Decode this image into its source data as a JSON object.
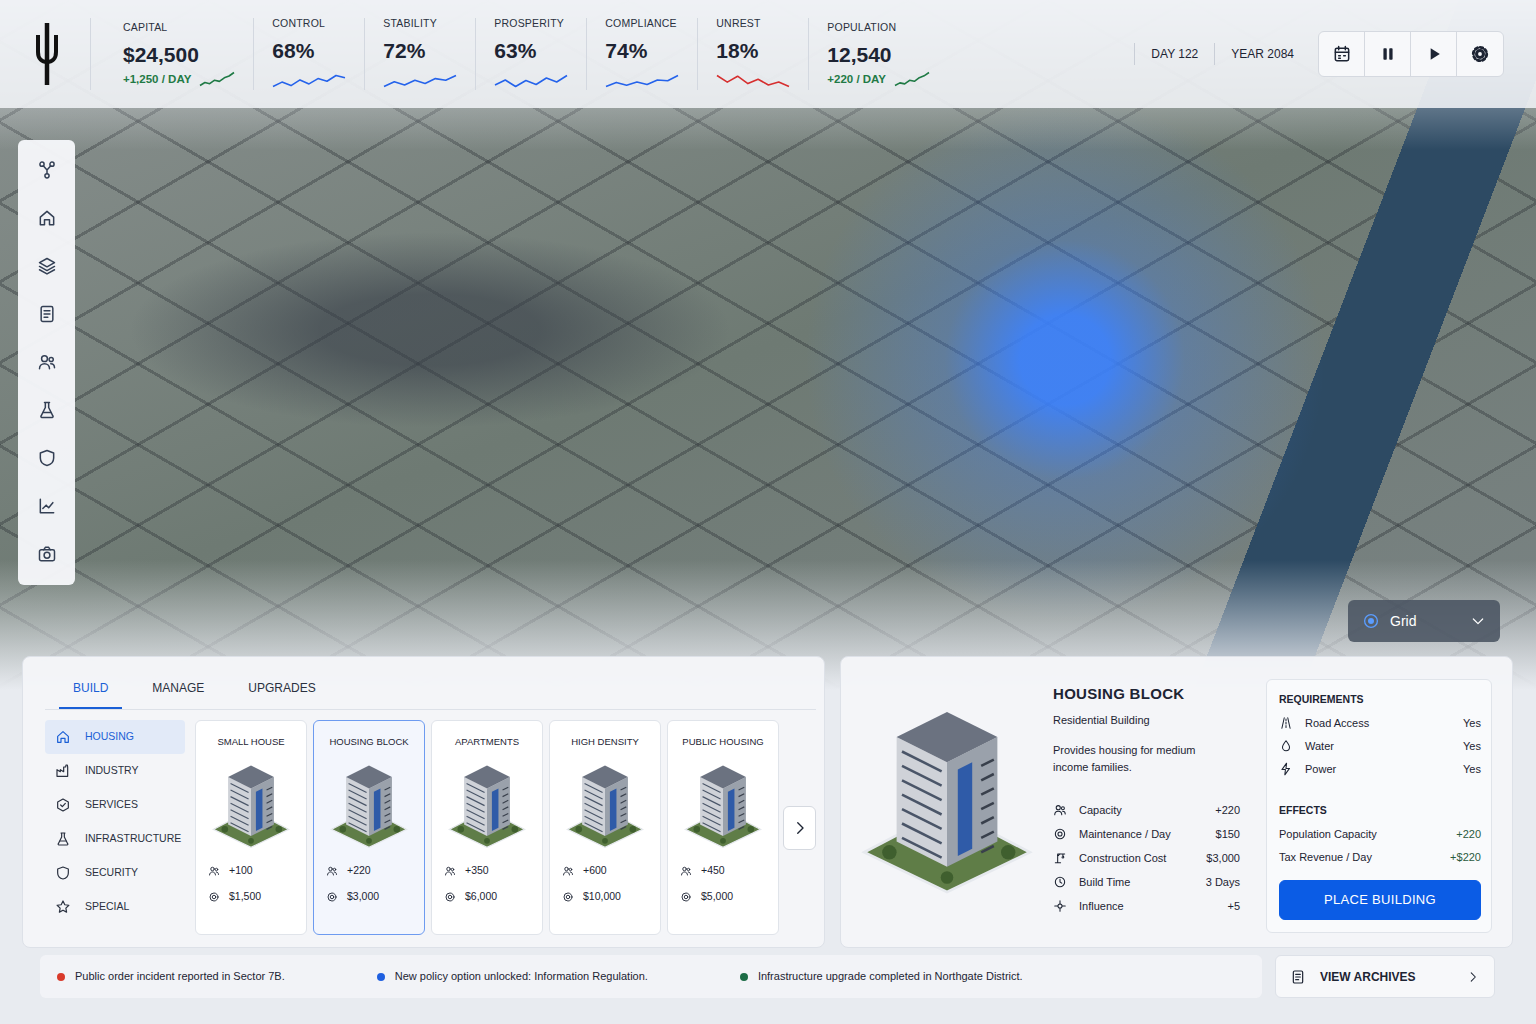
{
  "stats": [
    {
      "label": "CAPITAL",
      "value": "$24,500",
      "delta": "+1,250 / DAY",
      "trend": [
        2,
        3,
        2.6,
        3.8,
        3.4,
        4.6,
        5.2,
        6.4
      ],
      "color": "#1f7a45"
    },
    {
      "label": "CONTROL",
      "value": "68%",
      "trend": [
        3,
        4,
        3.2,
        4.5,
        3.6,
        4.8,
        4.2,
        5.5,
        5
      ],
      "color": "#2563eb"
    },
    {
      "label": "STABILITY",
      "value": "72%",
      "trend": [
        3,
        4.2,
        3.4,
        4.6,
        3.8,
        5,
        4.6,
        5.8
      ],
      "color": "#2563eb"
    },
    {
      "label": "PROSPERITY",
      "value": "63%",
      "trend": [
        3.5,
        4.5,
        3.2,
        4.4,
        3.6,
        4.9,
        4.1,
        5.4
      ],
      "color": "#2563eb"
    },
    {
      "label": "COMPLIANCE",
      "value": "74%",
      "trend": [
        3,
        4,
        3.3,
        4.1,
        3.5,
        4.6,
        4.4,
        5.7
      ],
      "color": "#2563eb"
    },
    {
      "label": "UNREST",
      "value": "18%",
      "trend": [
        4.5,
        3.6,
        4.4,
        3.4,
        4,
        3.2,
        3.6,
        3
      ],
      "color": "#d62f2f"
    },
    {
      "label": "POPULATION",
      "value": "12,540",
      "delta": "+220 / DAY",
      "trend": [
        2,
        2.8,
        2.5,
        3.6,
        3.3,
        4.4,
        5,
        6
      ],
      "color": "#1f7a45"
    }
  ],
  "clock": {
    "day": "DAY 122",
    "year": "YEAR 2084"
  },
  "controls": [
    {
      "kind": "calendar"
    },
    {
      "kind": "pause"
    },
    {
      "kind": "play"
    },
    {
      "kind": "settings"
    }
  ],
  "sidebar": {
    "items": [
      {
        "kind": "network"
      },
      {
        "kind": "home"
      },
      {
        "kind": "layers"
      },
      {
        "kind": "document"
      },
      {
        "kind": "people"
      },
      {
        "kind": "flask"
      },
      {
        "kind": "shield"
      },
      {
        "kind": "chart"
      },
      {
        "kind": "camera"
      }
    ]
  },
  "map_overlay": {
    "label": "Grid",
    "expanded": false
  },
  "build_panel": {
    "tabs": [
      {
        "label": "BUILD",
        "selected": true
      },
      {
        "label": "MANAGE",
        "selected": false
      },
      {
        "label": "UPGRADES",
        "selected": false
      }
    ],
    "categories": [
      {
        "label": "HOUSING",
        "kind": "home",
        "selected": true
      },
      {
        "label": "INDUSTRY",
        "kind": "factory",
        "selected": false
      },
      {
        "label": "SERVICES",
        "kind": "services",
        "selected": false
      },
      {
        "label": "INFRASTRUCTURE",
        "kind": "flask",
        "selected": false
      },
      {
        "label": "SECURITY",
        "kind": "shield",
        "selected": false
      },
      {
        "label": "SPECIAL",
        "kind": "star",
        "selected": false
      }
    ],
    "buildings": [
      {
        "name": "SMALL HOUSE",
        "capacity": "+100",
        "cost": "$1,500",
        "selected": false
      },
      {
        "name": "HOUSING BLOCK",
        "capacity": "+220",
        "cost": "$3,000",
        "selected": true
      },
      {
        "name": "APARTMENTS",
        "capacity": "+350",
        "cost": "$6,000",
        "selected": false
      },
      {
        "name": "HIGH DENSITY",
        "capacity": "+600",
        "cost": "$10,000",
        "selected": false
      },
      {
        "name": "PUBLIC HOUSING",
        "capacity": "+450",
        "cost": "$5,000",
        "selected": false
      }
    ]
  },
  "detail": {
    "title": "HOUSING BLOCK",
    "subtitle": "Residential Building",
    "description": "Provides housing for medium income families.",
    "stats": [
      {
        "label": "Capacity",
        "value": "+220",
        "kind": "people"
      },
      {
        "label": "Maintenance / Day",
        "value": "$150",
        "kind": "coin"
      },
      {
        "label": "Construction Cost",
        "value": "$3,000",
        "kind": "crane"
      },
      {
        "label": "Build Time",
        "value": "3 Days",
        "kind": "clock"
      },
      {
        "label": "Influence",
        "value": "+5",
        "kind": "influence"
      }
    ],
    "requirements": {
      "title": "REQUIREMENTS",
      "items": [
        {
          "label": "Road Access",
          "value": "Yes",
          "kind": "road"
        },
        {
          "label": "Water",
          "value": "Yes",
          "kind": "water"
        },
        {
          "label": "Power",
          "value": "Yes",
          "kind": "power"
        }
      ]
    },
    "effects": {
      "title": "EFFECTS",
      "items": [
        {
          "label": "Population Capacity",
          "value": "+220"
        },
        {
          "label": "Tax Revenue / Day",
          "value": "+$220"
        }
      ]
    },
    "button": "PLACE BUILDING"
  },
  "news": [
    {
      "text": "Public order incident reported in Sector 7B.",
      "color": "#d93a2b"
    },
    {
      "text": "New policy option unlocked: Information Regulation.",
      "color": "#1f5fe0"
    },
    {
      "text": "Infrastructure upgrade completed in Northgate District.",
      "color": "#1c6b45"
    }
  ],
  "archives": {
    "label": "VIEW ARCHIVES"
  }
}
